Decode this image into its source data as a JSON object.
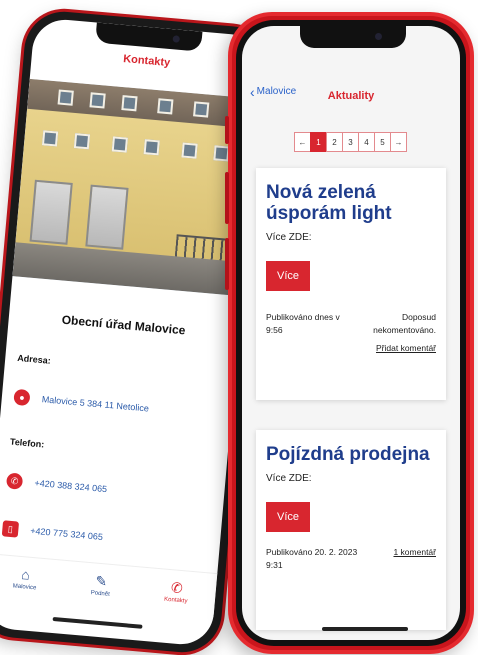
{
  "back_screen": {
    "title": "Kontakty",
    "office_name": "Obecní úřad Malovice",
    "address_label": "Adresa:",
    "address": "Malovice 5 384 11 Netolice",
    "phone_label": "Telefon:",
    "phones": [
      "+420 388 324 065",
      "+420 775 324 065"
    ],
    "tabs": [
      {
        "label": "Malovice",
        "icon": "home-icon",
        "active": false
      },
      {
        "label": "Podnět",
        "icon": "edit-icon",
        "active": false
      },
      {
        "label": "Kontakty",
        "icon": "phone-icon",
        "active": true
      }
    ]
  },
  "front_screen": {
    "back_label": "Malovice",
    "title": "Aktuality",
    "pagination": {
      "prev": "←",
      "pages": [
        "1",
        "2",
        "3",
        "4",
        "5"
      ],
      "next": "→",
      "current": "1"
    },
    "articles": [
      {
        "title": "Nová zelená úsporám light",
        "subtitle": "Více ZDE:",
        "button": "Více",
        "published": "Publikováno dnes v 9:56",
        "comments": "Doposud nekomentováno.",
        "add_comment": "Přidat komentář"
      },
      {
        "title": "Pojízdná prodejna",
        "subtitle": "Více ZDE:",
        "button": "Více",
        "published": "Publikováno 20. 2. 2023 9:31",
        "comments": "1 komentář"
      }
    ]
  },
  "colors": {
    "accent": "#d8262f",
    "brand_blue": "#1f3d8c",
    "link": "#2a5aa9"
  }
}
